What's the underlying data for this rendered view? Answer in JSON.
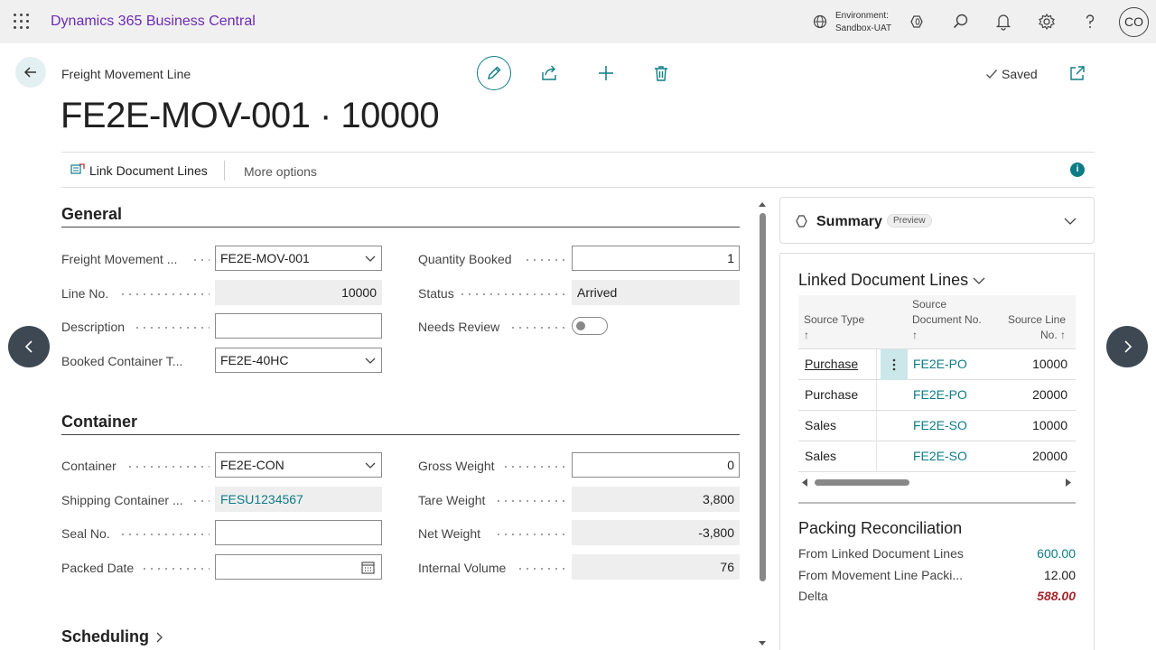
{
  "app": {
    "title": "Dynamics 365 Business Central"
  },
  "environment": {
    "label": "Environment:",
    "name": "Sandbox-UAT"
  },
  "user": {
    "initials": "CO"
  },
  "page": {
    "caption": "Freight Movement Line",
    "title": "FE2E-MOV-001 · 10000",
    "saved_label": "Saved"
  },
  "actionbar": {
    "link_document_lines": "Link Document Lines",
    "more_options": "More options",
    "info": "i"
  },
  "general": {
    "heading": "General",
    "fields": {
      "freight_movement": {
        "label": "Freight Movement ...",
        "value": "FE2E-MOV-001"
      },
      "line_no": {
        "label": "Line No.",
        "value": "10000"
      },
      "description": {
        "label": "Description",
        "value": ""
      },
      "booked_container_type": {
        "label": "Booked Container T...",
        "value": "FE2E-40HC"
      },
      "quantity_booked": {
        "label": "Quantity Booked",
        "value": "1"
      },
      "status": {
        "label": "Status",
        "value": "Arrived"
      },
      "needs_review": {
        "label": "Needs Review",
        "value": false
      }
    }
  },
  "container": {
    "heading": "Container",
    "fields": {
      "container": {
        "label": "Container",
        "value": "FE2E-CON"
      },
      "shipping_container": {
        "label": "Shipping Container ...",
        "value": "FESU1234567"
      },
      "seal_no": {
        "label": "Seal No.",
        "value": ""
      },
      "packed_date": {
        "label": "Packed Date",
        "value": ""
      },
      "gross_weight": {
        "label": "Gross Weight",
        "value": "0"
      },
      "tare_weight": {
        "label": "Tare Weight",
        "value": "3,800"
      },
      "net_weight": {
        "label": "Net Weight",
        "value": "-3,800"
      },
      "internal_volume": {
        "label": "Internal Volume",
        "value": "76"
      }
    }
  },
  "scheduling": {
    "heading": "Scheduling"
  },
  "summary": {
    "title": "Summary",
    "badge": "Preview"
  },
  "linked_document_lines": {
    "title": "Linked Document Lines",
    "columns": {
      "source_type": [
        "Source Type",
        "↑"
      ],
      "source_doc_no": [
        "Source",
        "Document No.",
        "↑"
      ],
      "source_line_no": [
        "Source Line",
        "No. ↑"
      ]
    },
    "rows": [
      {
        "source_type": "Purchase",
        "source_doc_no": "FE2E-PO",
        "source_line_no": "10000"
      },
      {
        "source_type": "Purchase",
        "source_doc_no": "FE2E-PO",
        "source_line_no": "20000"
      },
      {
        "source_type": "Sales",
        "source_doc_no": "FE2E-SO",
        "source_line_no": "10000"
      },
      {
        "source_type": "Sales",
        "source_doc_no": "FE2E-SO",
        "source_line_no": "20000"
      }
    ]
  },
  "packing_reconciliation": {
    "title": "Packing Reconciliation",
    "rows": [
      {
        "label": "From Linked Document Lines",
        "value": "600.00"
      },
      {
        "label": "From Movement Line Packi...",
        "value": "12.00"
      },
      {
        "label": "Delta",
        "value": "588.00"
      }
    ]
  },
  "colors": {
    "accent": "#0e7c86",
    "brand": "#6b2bb5",
    "delta": "#a4262c"
  },
  "icons": [
    "waffle-icon",
    "environment-icon",
    "copilot-icon",
    "search-icon",
    "bell-icon",
    "gear-icon",
    "help-icon",
    "back-arrow-icon",
    "pencil-icon",
    "share-icon",
    "plus-icon",
    "trash-icon",
    "check-icon",
    "open-new-window-icon",
    "link-lines-icon",
    "chevron-down-icon",
    "calendar-icon",
    "chevron-left-icon",
    "chevron-right-icon",
    "more-vertical-icon"
  ]
}
